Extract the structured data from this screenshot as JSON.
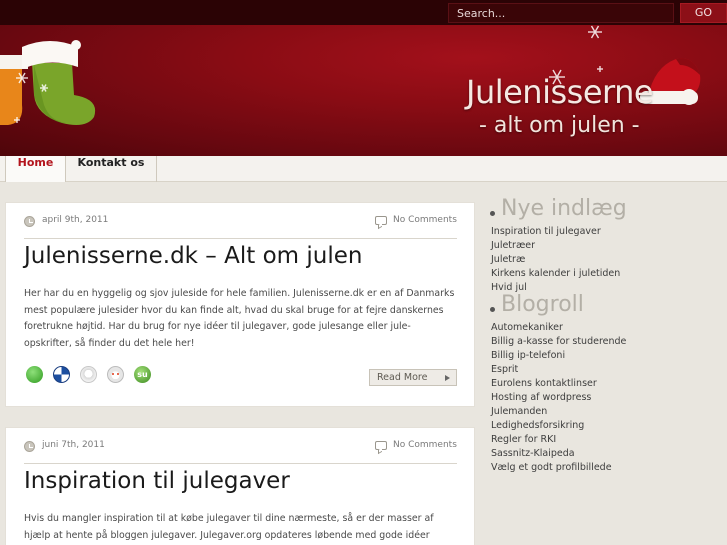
{
  "search": {
    "placeholder": "Search...",
    "go_label": "GO"
  },
  "header": {
    "title": "Julenisserne",
    "tagline": "- alt om julen -"
  },
  "nav": {
    "items": [
      {
        "label": "Home"
      },
      {
        "label": "Kontakt os"
      }
    ]
  },
  "posts": [
    {
      "date": "april 9th, 2011",
      "comments": "No Comments",
      "title": "Julenisserne.dk – Alt om julen",
      "body": "Her har du en hyggelig og sjov juleside for hele familien. Julenisserne.dk er en af Danmarks mest populære julesider hvor du kan finde alt, hvad du skal bruge for at fejre danskernes foretrukne højtid. Har du brug for nye idéer til julegaver, gode julesange eller jule-opskrifter, så finder du det hele her!",
      "read_more": "Read More",
      "share_icons": [
        "technorati-icon",
        "delicious-icon",
        "digg-icon",
        "reddit-icon",
        "stumbleupon-icon"
      ]
    },
    {
      "date": "juni 7th, 2011",
      "comments": "No Comments",
      "title": "Inspiration til julegaver",
      "body": "Hvis du mangler inspiration til at købe julegaver til dine nærmeste, så er der masser af hjælp at hente på bloggen julegaver. Julegaver.org opdateres løbende med gode idéer"
    }
  ],
  "sidebar": {
    "recent_title": "Nye indlæg",
    "recent": [
      "Inspiration til julegaver",
      "Juletræer",
      "Juletræ",
      "Kirkens kalender i juletiden",
      "Hvid jul"
    ],
    "blogroll_title": "Blogroll",
    "blogroll": [
      "Automekaniker",
      "Billig a-kasse for studerende",
      "Billig ip-telefoni",
      "Esprit",
      "Eurolens kontaktlinser",
      "Hosting af wordpress",
      "Julemanden",
      "Ledighedsforsikring",
      "Regler for RKI",
      "Sassnitz-Klaipeda",
      "Vælg et godt profilbillede"
    ]
  },
  "colors": {
    "header_red": "#8a0c14",
    "topbar": "#2b0305",
    "nav_active": "#b3141d",
    "page_bg": "#e9e6df"
  }
}
